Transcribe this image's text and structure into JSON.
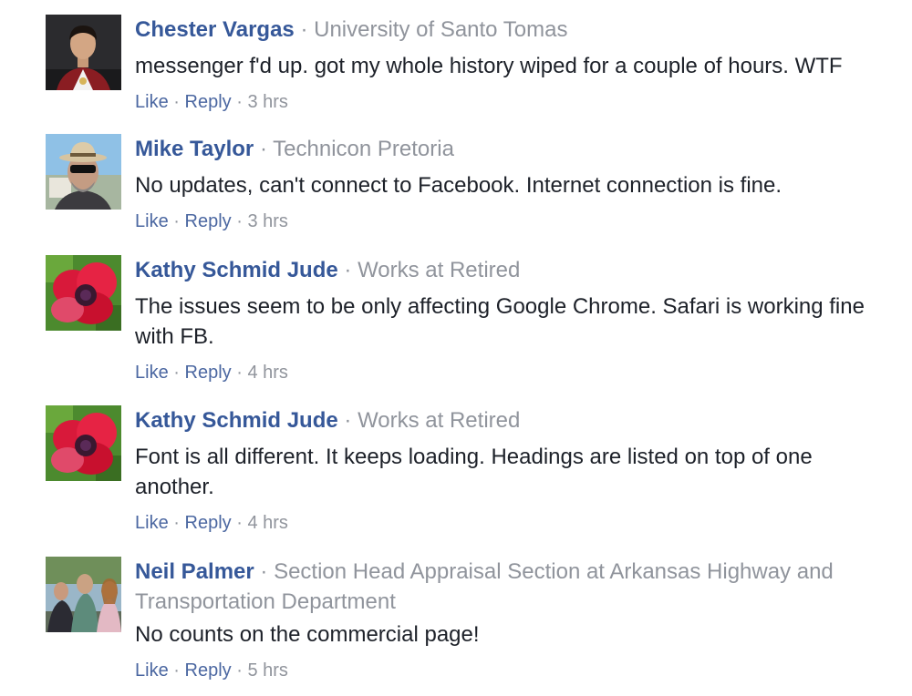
{
  "comments": [
    {
      "author": "Chester Vargas",
      "affiliation": "University of Santo Tomas",
      "text": "messenger f'd up. got my whole history wiped for a couple of hours. WTF",
      "like_label": "Like",
      "reply_label": "Reply",
      "time": "3 hrs",
      "avatar_icon": "graduation-portrait"
    },
    {
      "author": "Mike Taylor",
      "affiliation": "Technicon Pretoria",
      "text": "No updates, can't connect to Facebook. Internet connection is fine.",
      "like_label": "Like",
      "reply_label": "Reply",
      "time": "3 hrs",
      "avatar_icon": "man-with-hat-portrait"
    },
    {
      "author": "Kathy Schmid Jude",
      "affiliation": "Works at Retired",
      "text": "The issues seem to be only affecting Google Chrome. Safari is working fine with FB.",
      "like_label": "Like",
      "reply_label": "Reply",
      "time": "4 hrs",
      "avatar_icon": "red-poppy-flower"
    },
    {
      "author": "Kathy Schmid Jude",
      "affiliation": "Works at Retired",
      "text": "Font is all different. It keeps loading. Headings are listed on top of one another.",
      "like_label": "Like",
      "reply_label": "Reply",
      "time": "4 hrs",
      "avatar_icon": "red-poppy-flower"
    },
    {
      "author": "Neil Palmer",
      "affiliation": "Section Head Appraisal Section at Arkansas Highway and Transportation Department",
      "text": "No counts on the commercial page!",
      "like_label": "Like",
      "reply_label": "Reply",
      "time": "5 hrs",
      "avatar_icon": "group-photo"
    }
  ],
  "separator": "·",
  "colors": {
    "author": "#365899",
    "meta": "#90949c",
    "action": "#4b67a1",
    "text": "#1d2129"
  }
}
